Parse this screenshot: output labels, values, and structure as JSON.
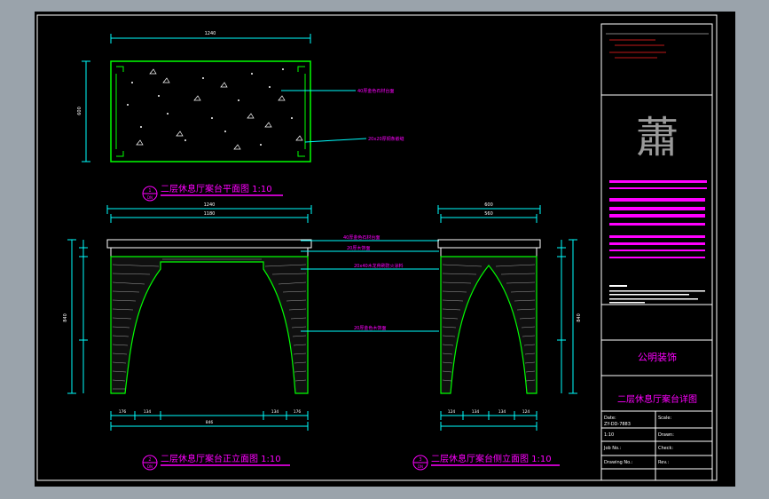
{
  "drawing": {
    "plan": {
      "title": "二层休息厅案台平面图 1:10",
      "marker_no": "1",
      "marker_sheet": "DN",
      "width_dim": "1240",
      "depth_dim": "600",
      "callouts": [
        "40厚金色石材台面",
        "20x20厚铜条嵌缝"
      ]
    },
    "front_elevation": {
      "title": "二层休息厅案台正立面图 1:10",
      "marker_no": "2",
      "marker_sheet": "DN",
      "top_dims": [
        "1240",
        "1180"
      ],
      "bottom_dims": [
        "176",
        "134",
        "134",
        "176",
        "846"
      ],
      "height_dim": "840",
      "callouts": [
        "40厚金色石材台面",
        "20厚木饰面",
        "20x40木龙骨刷防火涂料",
        "20厚金色木饰面"
      ]
    },
    "side_elevation": {
      "title": "二层休息厅案台侧立面图 1:10",
      "marker_no": "3",
      "marker_sheet": "DN",
      "top_dims": [
        "600",
        "560"
      ],
      "bottom_dims": [
        "124",
        "134",
        "134",
        "124"
      ],
      "height_dim": "840"
    }
  },
  "title_block": {
    "company": "公明装饰",
    "sheet_title": "二层休息厅案台详图",
    "drawing_no": "ZY-DD-7883",
    "scale_value": "1:10",
    "labels": [
      "Date:",
      "Scale:",
      "Drawn:",
      "Job No.:",
      "Check:",
      "Drawing No.:",
      "Rev.:"
    ]
  },
  "colors": {
    "line": "#00ff00",
    "dim": "#00ffff",
    "title": "#ff00ff",
    "red": "#ff2020",
    "white": "#ffffff"
  }
}
